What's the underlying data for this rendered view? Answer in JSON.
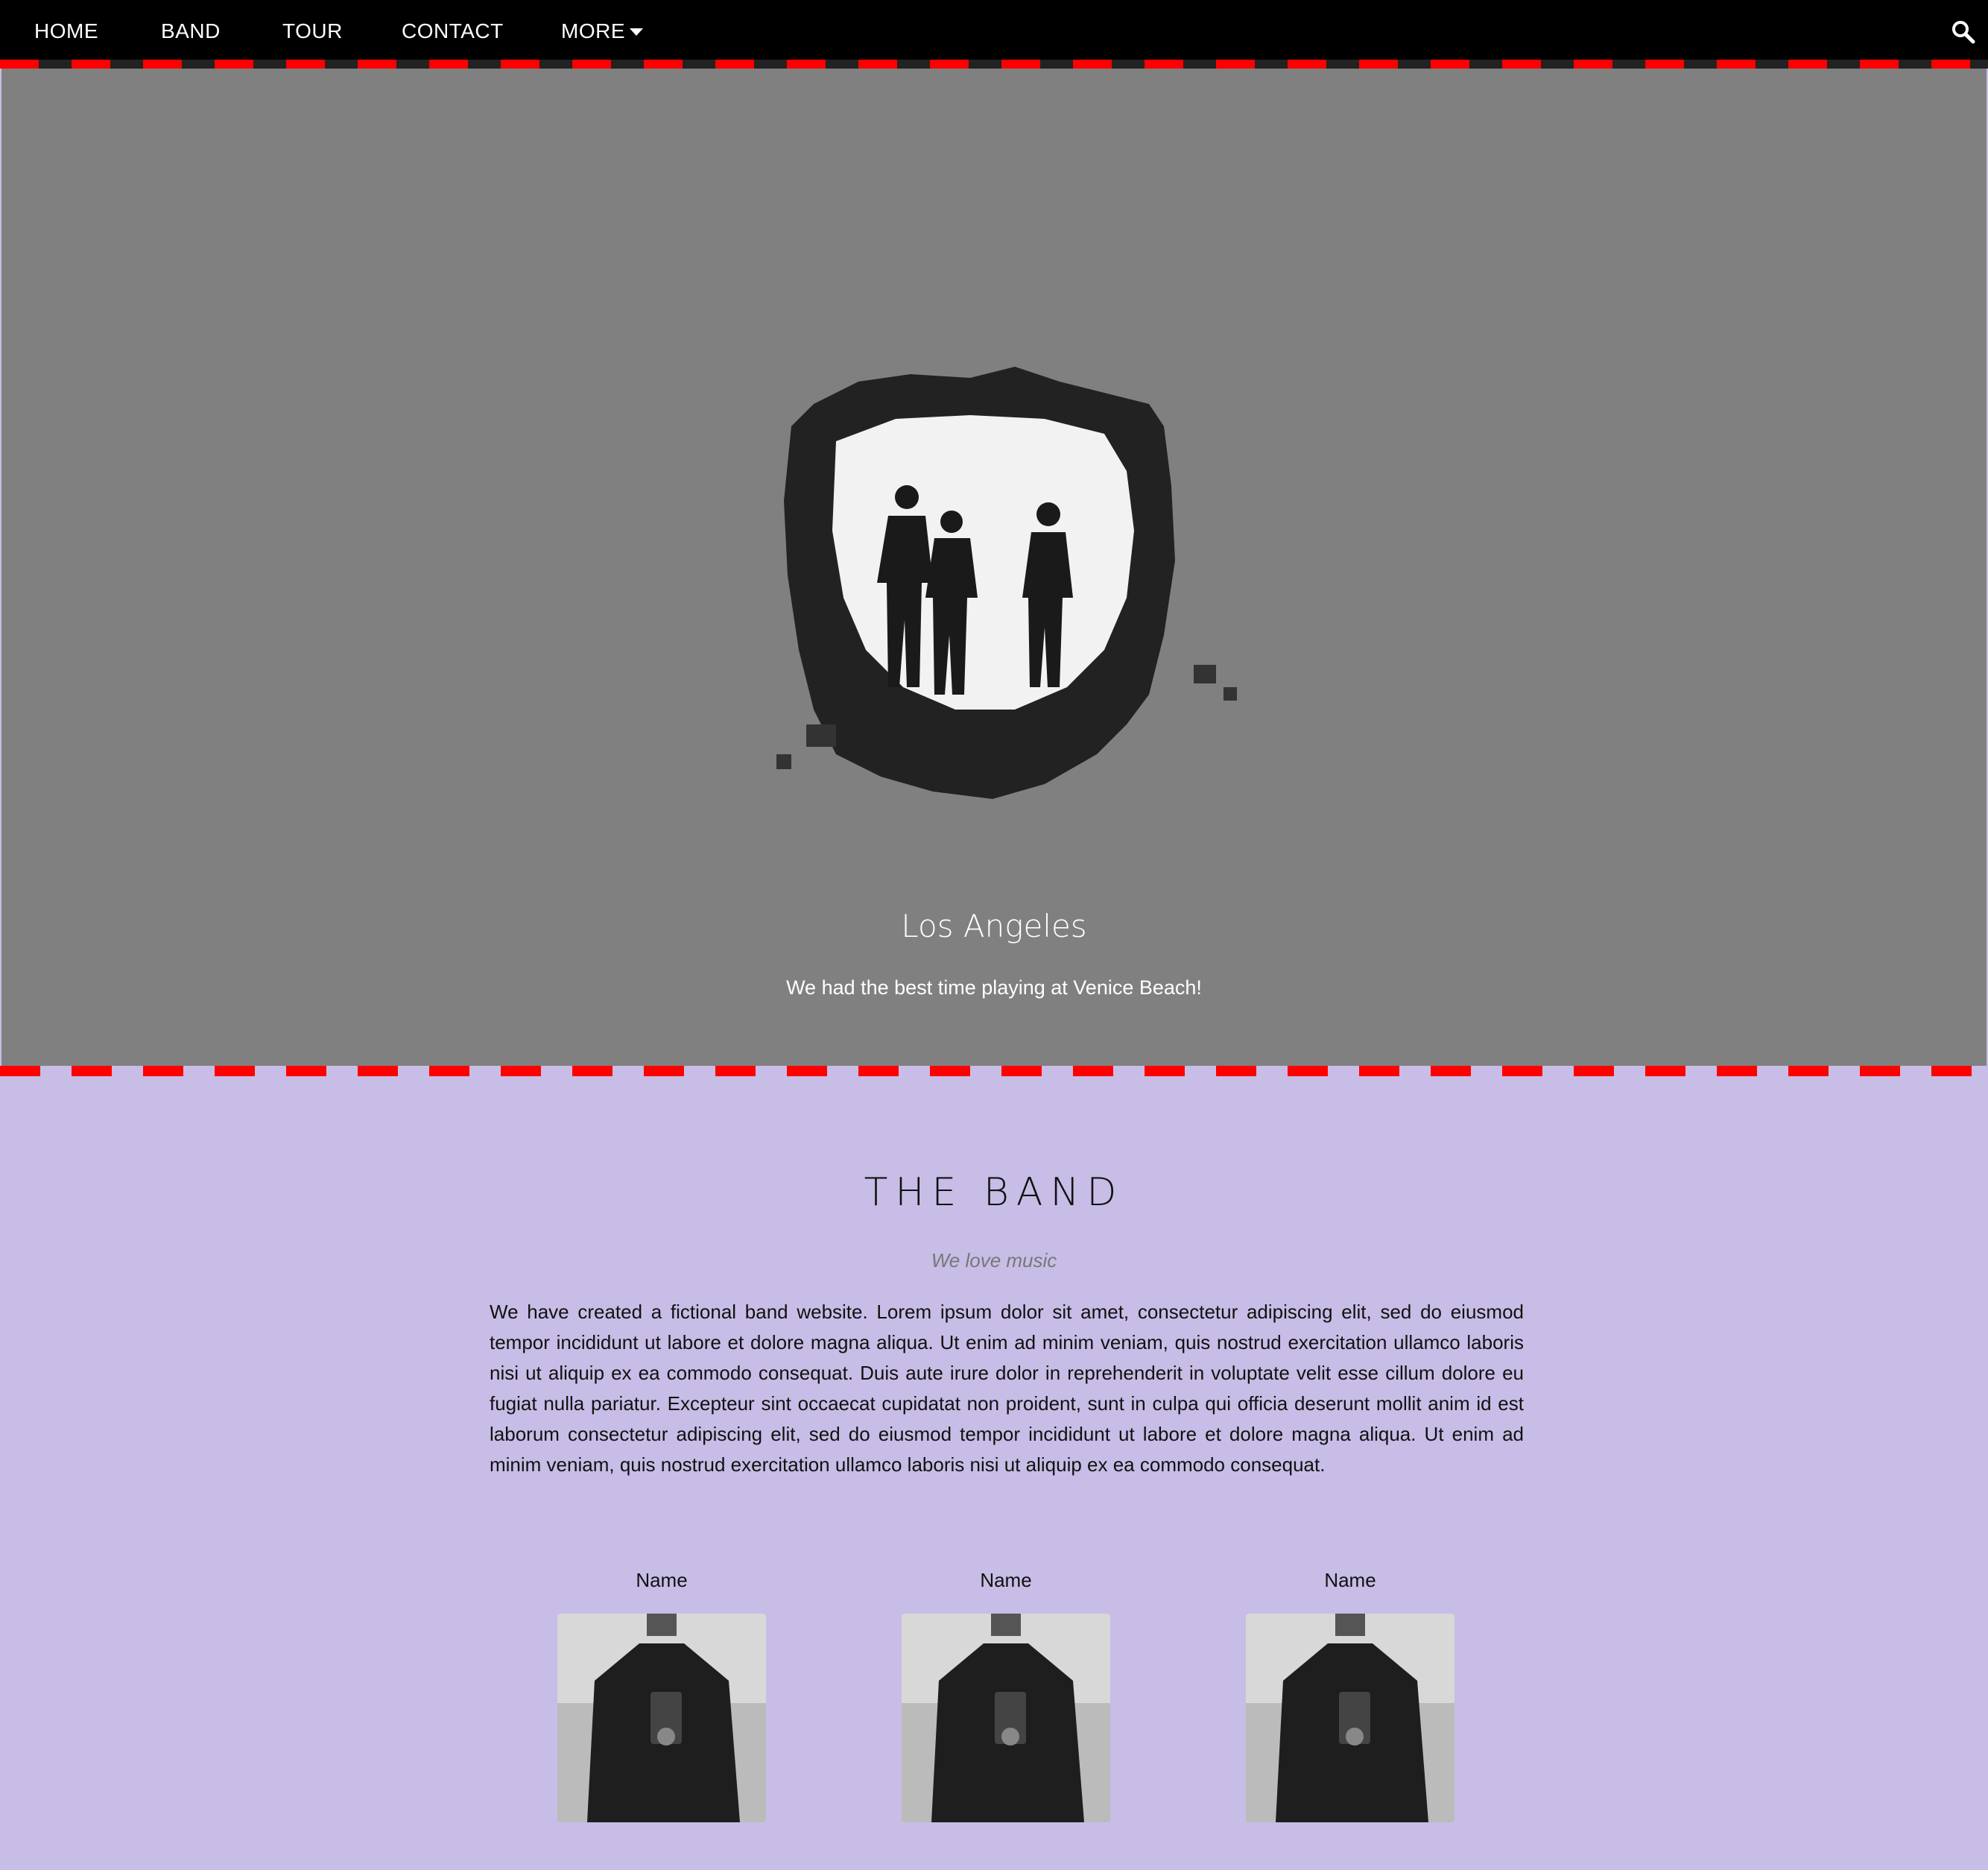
{
  "nav": {
    "items": [
      "HOME",
      "BAND",
      "TOUR",
      "CONTACT"
    ],
    "more_label": "MORE"
  },
  "hero": {
    "title": "Los Angeles",
    "subtitle": "We had the best time playing at Venice Beach!"
  },
  "band": {
    "title": "THE BAND",
    "tagline": "We love music",
    "body": "We have created a fictional band website. Lorem ipsum dolor sit amet, consectetur adipiscing elit, sed do eiusmod tempor incididunt ut labore et dolore magna aliqua. Ut enim ad minim veniam, quis nostrud exercitation ullamco laboris nisi ut aliquip ex ea commodo consequat. Duis aute irure dolor in reprehenderit in voluptate velit esse cillum dolore eu fugiat nulla pariatur. Excepteur sint occaecat cupidatat non proident, sunt in culpa qui officia deserunt mollit anim id est laborum consectetur adipiscing elit, sed do eiusmod tempor incididunt ut labore et dolore magna aliqua. Ut enim ad minim veniam, quis nostrud exercitation ullamco laboris nisi ut aliquip ex ea commodo consequat.",
    "members": [
      {
        "name": "Name"
      },
      {
        "name": "Name"
      },
      {
        "name": "Name"
      }
    ]
  },
  "colors": {
    "nav_bg": "#000000",
    "accent_dash": "#ff0000",
    "hero_bg": "#808080",
    "section_bg": "#c8bde6"
  },
  "icons": {
    "search": "search-icon",
    "more_caret": "caret-down-icon"
  }
}
